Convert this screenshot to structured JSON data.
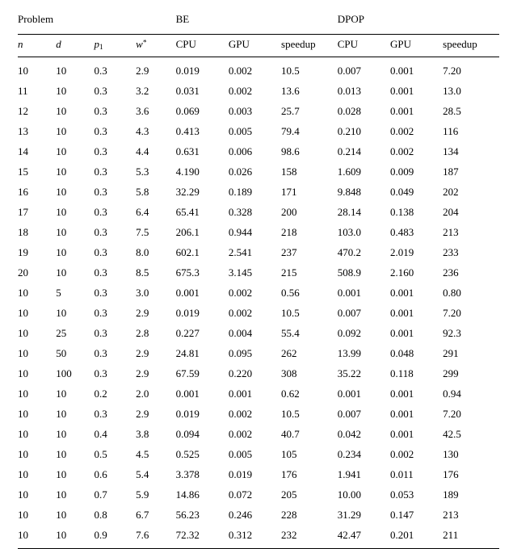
{
  "chart_data": {
    "type": "table",
    "title": "",
    "group_headers": [
      "Problem",
      "BE",
      "DPOP"
    ],
    "columns": {
      "problem": [
        "n",
        "d",
        "p1",
        "w*"
      ],
      "be": [
        "CPU",
        "GPU",
        "speedup"
      ],
      "dpop": [
        "CPU",
        "GPU",
        "speedup"
      ]
    },
    "rows": [
      {
        "n": 10,
        "d": 10,
        "p1": 0.3,
        "w": "2.9",
        "be_cpu": "0.019",
        "be_gpu": "0.002",
        "be_sp": "10.5",
        "dp_cpu": "0.007",
        "dp_gpu": "0.001",
        "dp_sp": "7.20"
      },
      {
        "n": 11,
        "d": 10,
        "p1": 0.3,
        "w": "3.2",
        "be_cpu": "0.031",
        "be_gpu": "0.002",
        "be_sp": "13.6",
        "dp_cpu": "0.013",
        "dp_gpu": "0.001",
        "dp_sp": "13.0"
      },
      {
        "n": 12,
        "d": 10,
        "p1": 0.3,
        "w": "3.6",
        "be_cpu": "0.069",
        "be_gpu": "0.003",
        "be_sp": "25.7",
        "dp_cpu": "0.028",
        "dp_gpu": "0.001",
        "dp_sp": "28.5"
      },
      {
        "n": 13,
        "d": 10,
        "p1": 0.3,
        "w": "4.3",
        "be_cpu": "0.413",
        "be_gpu": "0.005",
        "be_sp": "79.4",
        "dp_cpu": "0.210",
        "dp_gpu": "0.002",
        "dp_sp": "116"
      },
      {
        "n": 14,
        "d": 10,
        "p1": 0.3,
        "w": "4.4",
        "be_cpu": "0.631",
        "be_gpu": "0.006",
        "be_sp": "98.6",
        "dp_cpu": "0.214",
        "dp_gpu": "0.002",
        "dp_sp": "134"
      },
      {
        "n": 15,
        "d": 10,
        "p1": 0.3,
        "w": "5.3",
        "be_cpu": "4.190",
        "be_gpu": "0.026",
        "be_sp": "158",
        "dp_cpu": "1.609",
        "dp_gpu": "0.009",
        "dp_sp": "187"
      },
      {
        "n": 16,
        "d": 10,
        "p1": 0.3,
        "w": "5.8",
        "be_cpu": "32.29",
        "be_gpu": "0.189",
        "be_sp": "171",
        "dp_cpu": "9.848",
        "dp_gpu": "0.049",
        "dp_sp": "202"
      },
      {
        "n": 17,
        "d": 10,
        "p1": 0.3,
        "w": "6.4",
        "be_cpu": "65.41",
        "be_gpu": "0.328",
        "be_sp": "200",
        "dp_cpu": "28.14",
        "dp_gpu": "0.138",
        "dp_sp": "204"
      },
      {
        "n": 18,
        "d": 10,
        "p1": 0.3,
        "w": "7.5",
        "be_cpu": "206.1",
        "be_gpu": "0.944",
        "be_sp": "218",
        "dp_cpu": "103.0",
        "dp_gpu": "0.483",
        "dp_sp": "213"
      },
      {
        "n": 19,
        "d": 10,
        "p1": 0.3,
        "w": "8.0",
        "be_cpu": "602.1",
        "be_gpu": "2.541",
        "be_sp": "237",
        "dp_cpu": "470.2",
        "dp_gpu": "2.019",
        "dp_sp": "233"
      },
      {
        "n": 20,
        "d": 10,
        "p1": 0.3,
        "w": "8.5",
        "be_cpu": "675.3",
        "be_gpu": "3.145",
        "be_sp": "215",
        "dp_cpu": "508.9",
        "dp_gpu": "2.160",
        "dp_sp": "236"
      },
      {
        "n": 10,
        "d": 5,
        "p1": 0.3,
        "w": "3.0",
        "be_cpu": "0.001",
        "be_gpu": "0.002",
        "be_sp": "0.56",
        "dp_cpu": "0.001",
        "dp_gpu": "0.001",
        "dp_sp": "0.80"
      },
      {
        "n": 10,
        "d": 10,
        "p1": 0.3,
        "w": "2.9",
        "be_cpu": "0.019",
        "be_gpu": "0.002",
        "be_sp": "10.5",
        "dp_cpu": "0.007",
        "dp_gpu": "0.001",
        "dp_sp": "7.20"
      },
      {
        "n": 10,
        "d": 25,
        "p1": 0.3,
        "w": "2.8",
        "be_cpu": "0.227",
        "be_gpu": "0.004",
        "be_sp": "55.4",
        "dp_cpu": "0.092",
        "dp_gpu": "0.001",
        "dp_sp": "92.3"
      },
      {
        "n": 10,
        "d": 50,
        "p1": 0.3,
        "w": "2.9",
        "be_cpu": "24.81",
        "be_gpu": "0.095",
        "be_sp": "262",
        "dp_cpu": "13.99",
        "dp_gpu": "0.048",
        "dp_sp": "291"
      },
      {
        "n": 10,
        "d": 100,
        "p1": 0.3,
        "w": "2.9",
        "be_cpu": "67.59",
        "be_gpu": "0.220",
        "be_sp": "308",
        "dp_cpu": "35.22",
        "dp_gpu": "0.118",
        "dp_sp": "299"
      },
      {
        "n": 10,
        "d": 10,
        "p1": 0.2,
        "w": "2.0",
        "be_cpu": "0.001",
        "be_gpu": "0.001",
        "be_sp": "0.62",
        "dp_cpu": "0.001",
        "dp_gpu": "0.001",
        "dp_sp": "0.94"
      },
      {
        "n": 10,
        "d": 10,
        "p1": 0.3,
        "w": "2.9",
        "be_cpu": "0.019",
        "be_gpu": "0.002",
        "be_sp": "10.5",
        "dp_cpu": "0.007",
        "dp_gpu": "0.001",
        "dp_sp": "7.20"
      },
      {
        "n": 10,
        "d": 10,
        "p1": 0.4,
        "w": "3.8",
        "be_cpu": "0.094",
        "be_gpu": "0.002",
        "be_sp": "40.7",
        "dp_cpu": "0.042",
        "dp_gpu": "0.001",
        "dp_sp": "42.5"
      },
      {
        "n": 10,
        "d": 10,
        "p1": 0.5,
        "w": "4.5",
        "be_cpu": "0.525",
        "be_gpu": "0.005",
        "be_sp": "105",
        "dp_cpu": "0.234",
        "dp_gpu": "0.002",
        "dp_sp": "130"
      },
      {
        "n": 10,
        "d": 10,
        "p1": 0.6,
        "w": "5.4",
        "be_cpu": "3.378",
        "be_gpu": "0.019",
        "be_sp": "176",
        "dp_cpu": "1.941",
        "dp_gpu": "0.011",
        "dp_sp": "176"
      },
      {
        "n": 10,
        "d": 10,
        "p1": 0.7,
        "w": "5.9",
        "be_cpu": "14.86",
        "be_gpu": "0.072",
        "be_sp": "205",
        "dp_cpu": "10.00",
        "dp_gpu": "0.053",
        "dp_sp": "189"
      },
      {
        "n": 10,
        "d": 10,
        "p1": 0.8,
        "w": "6.7",
        "be_cpu": "56.23",
        "be_gpu": "0.246",
        "be_sp": "228",
        "dp_cpu": "31.29",
        "dp_gpu": "0.147",
        "dp_sp": "213"
      },
      {
        "n": 10,
        "d": 10,
        "p1": 0.9,
        "w": "7.6",
        "be_cpu": "72.32",
        "be_gpu": "0.312",
        "be_sp": "232",
        "dp_cpu": "42.47",
        "dp_gpu": "0.201",
        "dp_sp": "211"
      }
    ]
  }
}
